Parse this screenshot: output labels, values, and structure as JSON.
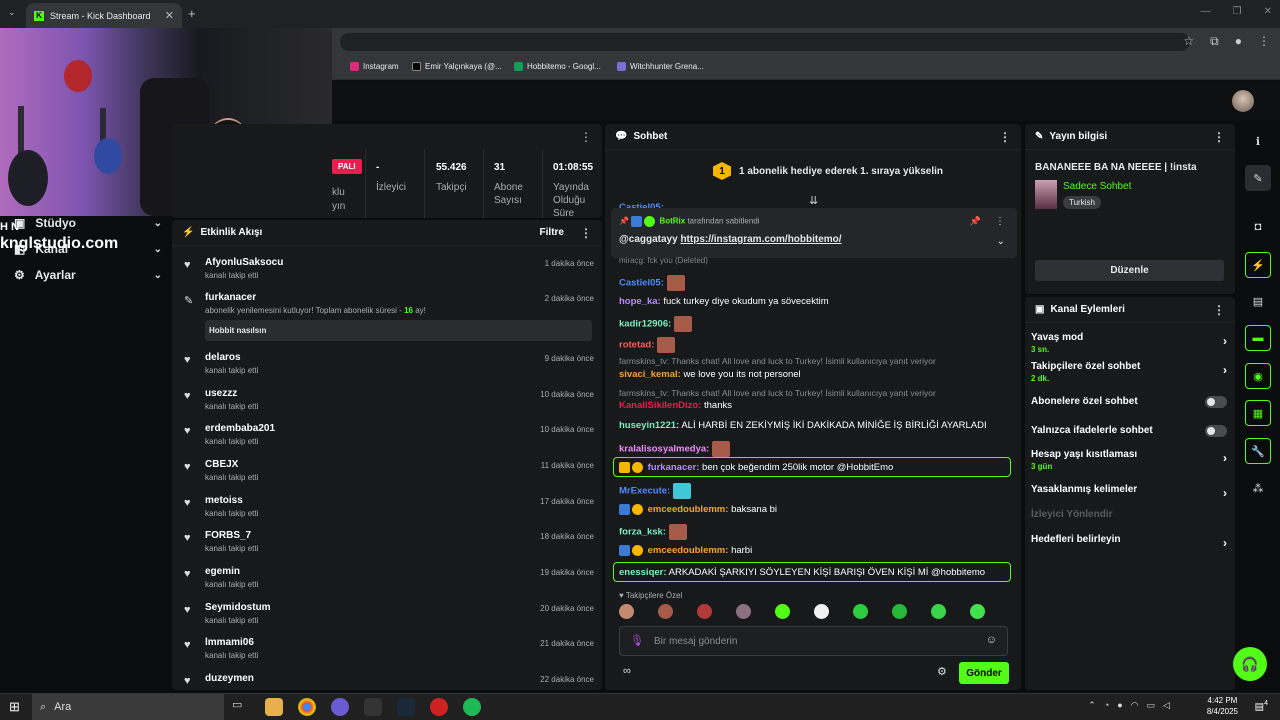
{
  "browser": {
    "tab_title": "Stream - Kick Dashboard",
    "new_tab": "+",
    "tab_close": "✕",
    "tab_search": "⌄",
    "bookmarks": [
      "Instagram",
      "Emir Yalçınkaya (@...",
      "Hobbitemo - Googl...",
      "Witchhunter Grena..."
    ]
  },
  "nav": {
    "items": [
      {
        "label": "Stüdyo"
      },
      {
        "label": "Kanal"
      },
      {
        "label": "Ayarlar"
      }
    ]
  },
  "watermark": {
    "line1": "H N",
    "line2": "knglstudio.com"
  },
  "stats": {
    "live": "PALI",
    "fragments": [
      "klu",
      "yın"
    ],
    "viewers_value": "-",
    "viewers_label": "İzleyici",
    "followers_value": "55.426",
    "followers_label": "Takipçi",
    "subs_value": "31",
    "subs_label": "Abone Sayısı",
    "uptime_value": "01:08:55",
    "uptime_label": "Yayında Olduğu Süre"
  },
  "activity": {
    "title": "Etkinlik Akışı",
    "filter": "Filtre",
    "items": [
      {
        "name": "AfyonluSaksocu",
        "sub": "kanalı takip etti",
        "time": "1 dakika önce"
      },
      {
        "name": "furkanacer",
        "sub": "abonelik yenilemesini kutluyor! Toplam abonelik süresi - 16 ay!",
        "time": "2 dakika önce",
        "message": "Hobbit nasılsın"
      },
      {
        "name": "delaros",
        "sub": "kanalı takip etti",
        "time": "9 dakika önce"
      },
      {
        "name": "usezzz",
        "sub": "kanalı takip etti",
        "time": "10 dakika önce"
      },
      {
        "name": "erdembaba201",
        "sub": "kanalı takip etti",
        "time": "10 dakika önce"
      },
      {
        "name": "CBEJX",
        "sub": "kanalı takip etti",
        "time": "11 dakika önce"
      },
      {
        "name": "metoiss",
        "sub": "kanalı takip etti",
        "time": "17 dakika önce"
      },
      {
        "name": "FORBS_7",
        "sub": "kanalı takip etti",
        "time": "18 dakika önce"
      },
      {
        "name": "egemin",
        "sub": "kanalı takip etti",
        "time": "19 dakika önce"
      },
      {
        "name": "Seymidostum",
        "sub": "kanalı takip etti",
        "time": "20 dakika önce"
      },
      {
        "name": "lmmami06",
        "sub": "kanalı takip etti",
        "time": "21 dakika önce"
      },
      {
        "name": "duzeymen",
        "sub": "",
        "time": "22 dakika önce"
      }
    ]
  },
  "chat": {
    "title": "Sohbet",
    "gift_number": "1",
    "gift_text": "1 abonelik hediye ederek 1. sıraya yükselin",
    "pinned_by": "BotRix",
    "pinned_suffix": "tarafından sabitlendi",
    "pinned_user": "@caggatayy",
    "pinned_link": "https://instagram.com/hobbitemo/",
    "m_castiel_top": "Castiel05:",
    "m_miracg": "mirac̦g: fck you (Deleted)",
    "m1_user": "Castiel05:",
    "m2_user": "hope_ka:",
    "m2_text": "fuck turkey diye okudum ya sövecektim",
    "m3_user": "kadir12906:",
    "m4_user": "rotetad:",
    "r1": "farmskins_tv: Thanks chat! All love and luck to Turkey! İsimli kullanıcıya yanıt veriyor",
    "m5_user": "sivaci_kemal:",
    "m5_text": "we love you its not personel",
    "r2": "farmskins_tv: Thanks chat! All love and luck to Turkey! İsimli kullanıcıya yanıt veriyor",
    "m6_user": "KanaliSikilenDizo:",
    "m6_text": "thanks",
    "m7_user": "huseyin1221:",
    "m7_text": "ALİ HARBİ EN ZEKİYMİŞ İKİ DAKİKADA MİNİĞE İŞ BİRLİĞİ AYARLADI",
    "m8_user": "kralalisosyalmedya:",
    "m9_user": "furkanacer:",
    "m9_text": "ben çok beğendim 250lik motor @HobbitEmo",
    "m10_user": "MrExecute:",
    "m11_user": "emceedoublemm:",
    "m11_text": "baksana bi",
    "m12_user": "forza_ksk:",
    "m13_user": "emceedoublemm:",
    "m13_text": "harbi",
    "m14_user": "enessiqer:",
    "m14_text": "ARKADAKİ ŞARKIYI SÖYLEYEN KİŞİ BARIŞI ÖVEN KİŞİ Mİ @hobbitemo",
    "followers_only": "Takipçilere Özel",
    "input_placeholder": "Bir mesaj gönderin",
    "send": "Gönder",
    "badge_num": "1"
  },
  "info": {
    "title": "Yayın bilgisi",
    "stream_title": "BANANEEE BA NA NEEEE | !insta",
    "category": "Sadece Sohbet",
    "language": "Turkish",
    "edit": "Düzenle"
  },
  "actions": {
    "title": "Kanal Eylemleri",
    "slow": "Yavaş mod",
    "slow_val": "3 sn.",
    "followers": "Takipçilere özel sohbet",
    "followers_val": "2 dk.",
    "subs": "Abonelere özel sohbet",
    "emotes": "Yalnızca ifadelerle sohbet",
    "age": "Hesap yaşı kısıtlaması",
    "age_val": "3 gün",
    "banned": "Yasaklanmış kelimeler",
    "host": "İzleyici Yönlendir",
    "goals": "Hedefleri belirleyin"
  },
  "taskbar": {
    "search": "Ara",
    "time": "4:42 PM",
    "date": "8/4/2025",
    "notif": "4"
  },
  "colors": {
    "accent": "#53fc18",
    "panel": "#18191b",
    "live": "#e91e4f"
  }
}
